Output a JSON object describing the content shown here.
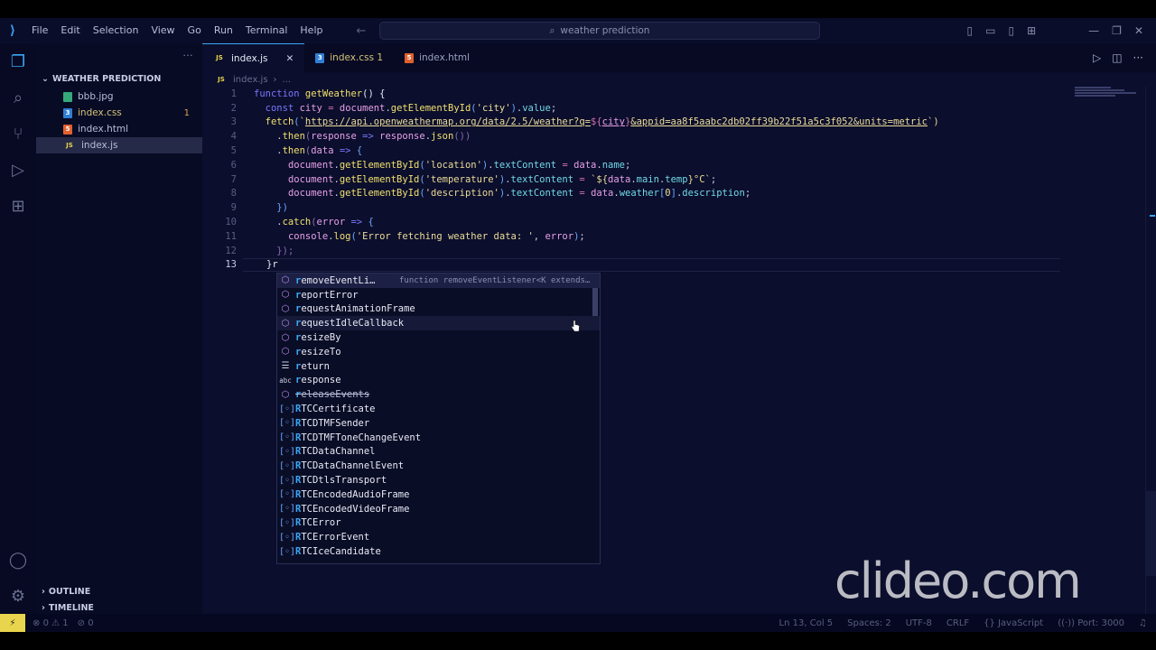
{
  "titlebar": {
    "menu": [
      "File",
      "Edit",
      "Selection",
      "View",
      "Go",
      "Run",
      "Terminal",
      "Help"
    ],
    "search": "weather prediction"
  },
  "sidebar": {
    "folder": "WEATHER PREDICTION",
    "files": [
      {
        "name": "bbb.jpg",
        "type": "img"
      },
      {
        "name": "index.css",
        "type": "css",
        "badge": "1"
      },
      {
        "name": "index.html",
        "type": "html"
      },
      {
        "name": "index.js",
        "type": "js"
      }
    ],
    "outline": "OUTLINE",
    "timeline": "TIMELINE"
  },
  "tabs": [
    {
      "label": "index.js",
      "icon": "JS"
    },
    {
      "label": "index.css 1"
    },
    {
      "label": "index.html"
    }
  ],
  "breadcrumb": {
    "file": "index.js",
    "rest": "..."
  },
  "code": {
    "l1": {
      "kw": "function",
      "fn": "getWeather",
      "rest": "() {"
    },
    "l2": {
      "kw": "const",
      "vr": "city",
      "op": "=",
      "obj": "document",
      "fn": "getElementById",
      "st": "'city'",
      "pr": "value"
    },
    "l3": {
      "fn": "fetch",
      "url": "https://api.openweathermap.org/data/2.5/weather?q=",
      "tmpl_open": "${",
      "var": "city",
      "tmpl_close": "}",
      "url2": "&appid=aa8f5aabc2db02ff39b22f51a5c3f052&units=metric",
      "end": "`)"
    },
    "l4": {
      "fn": "then",
      "param": "response",
      "arrow": "=>",
      "obj": "response",
      "fn2": "json",
      "end": "())"
    },
    "l5": {
      "fn": "then",
      "param": "data",
      "arrow": "=>",
      "end": "{"
    },
    "l6": {
      "obj": "document",
      "fn": "getElementById",
      "st": "'location'",
      "pr": "textContent",
      "op": "=",
      "val": "data",
      "pr2": "name"
    },
    "l7": {
      "obj": "document",
      "fn": "getElementById",
      "st": "'temperature'",
      "pr": "textContent",
      "op": "=",
      "t1": "`${",
      "val": "data",
      "pr2": "main",
      "pr3": "temp",
      "t2": "}°C`"
    },
    "l8": {
      "obj": "document",
      "fn": "getElementById",
      "st": "'description'",
      "pr": "textContent",
      "op": "=",
      "val": "data",
      "pr2": "weather",
      "idx": "0",
      "pr3": "description"
    },
    "l9": "})",
    "l10": {
      "fn": "catch",
      "param": "error",
      "arrow": "=>",
      "end": "{"
    },
    "l11": {
      "obj": "console",
      "fn": "log",
      "st": "'Error fetching weather data: '",
      "val": "error"
    },
    "l12": "});",
    "l13": "}r"
  },
  "suggestions": [
    {
      "m": "r",
      "rest": "emoveEventLi…",
      "kind": "method",
      "detail": "function removeEventListener<K extends…"
    },
    {
      "m": "r",
      "rest": "eportError",
      "kind": "method"
    },
    {
      "m": "r",
      "rest": "equestAnimationFrame",
      "kind": "method"
    },
    {
      "m": "r",
      "rest": "equestIdleCallback",
      "kind": "method"
    },
    {
      "m": "r",
      "rest": "esizeBy",
      "kind": "method"
    },
    {
      "m": "r",
      "rest": "esizeTo",
      "kind": "method"
    },
    {
      "m": "r",
      "rest": "eturn",
      "kind": "keyword"
    },
    {
      "m": "r",
      "rest": "esponse",
      "kind": "text"
    },
    {
      "m": "r",
      "rest": "eleaseEvents",
      "kind": "method",
      "strike": true
    },
    {
      "m": "R",
      "rest": "TCCertificate",
      "kind": "field"
    },
    {
      "m": "R",
      "rest": "TCDTMFSender",
      "kind": "field"
    },
    {
      "m": "R",
      "rest": "TCDTMFToneChangeEvent",
      "kind": "field"
    },
    {
      "m": "R",
      "rest": "TCDataChannel",
      "kind": "field"
    },
    {
      "m": "R",
      "rest": "TCDataChannelEvent",
      "kind": "field"
    },
    {
      "m": "R",
      "rest": "TCDtlsTransport",
      "kind": "field"
    },
    {
      "m": "R",
      "rest": "TCEncodedAudioFrame",
      "kind": "field"
    },
    {
      "m": "R",
      "rest": "TCEncodedVideoFrame",
      "kind": "field"
    },
    {
      "m": "R",
      "rest": "TCError",
      "kind": "field"
    },
    {
      "m": "R",
      "rest": "TCErrorEvent",
      "kind": "field"
    },
    {
      "m": "R",
      "rest": "TCIceCandidate",
      "kind": "field"
    }
  ],
  "status": {
    "errors": "0",
    "warnings": "1",
    "ports": "0",
    "position": "Ln 13, Col 5",
    "spaces": "Spaces: 2",
    "encoding": "UTF-8",
    "eol": "CRLF",
    "language": "JavaScript",
    "port": "Port: 3000"
  },
  "watermark": "clideo.com"
}
